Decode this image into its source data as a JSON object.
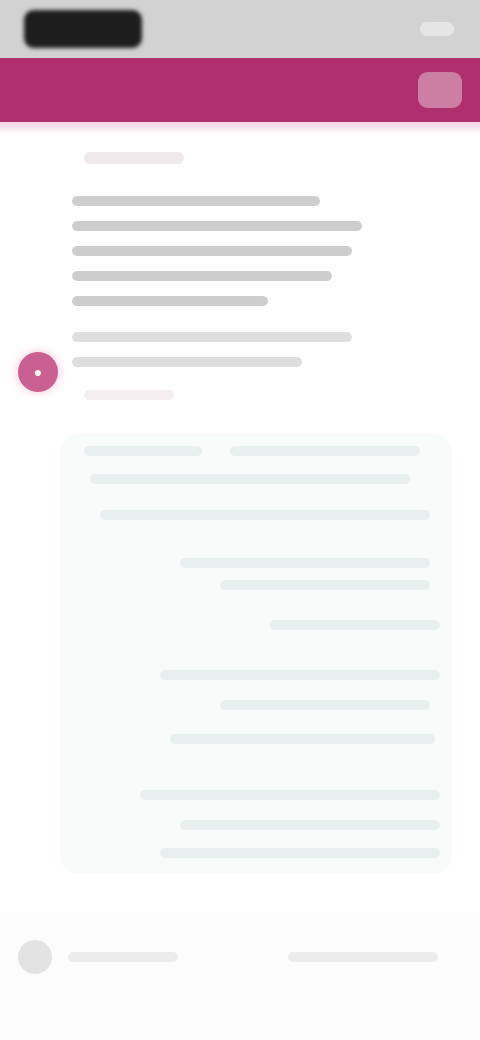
{
  "status_bar": {
    "time_text": "",
    "icons": [
      "signal-icon",
      "wifi-icon",
      "battery-icon"
    ]
  },
  "header": {
    "title": "",
    "action_icon": "more-icon",
    "accent_color": "#b0306d"
  },
  "message": {
    "label": "",
    "lines": [],
    "secondary_lines": [],
    "avatar_icon": "user-icon"
  },
  "suggestion_panel": {
    "lines": []
  },
  "bottom_bar": {
    "label": "",
    "right_label": ""
  }
}
